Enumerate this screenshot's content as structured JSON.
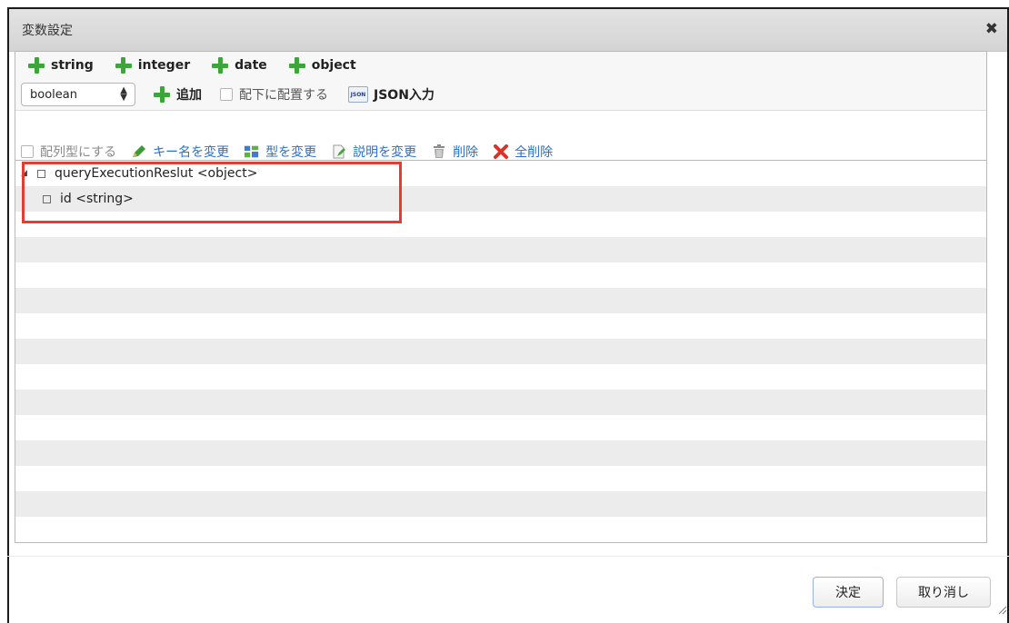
{
  "dialog": {
    "title": "変数設定"
  },
  "type_buttons": [
    "string",
    "integer",
    "date",
    "object"
  ],
  "row2": {
    "selected_type": "boolean",
    "add_label": "追加",
    "child_checkbox_label": "配下に配置する",
    "json_label": "JSON入力",
    "json_icon_text": "JSON"
  },
  "ops": {
    "array_checkbox_label": "配列型にする",
    "rename_key": "キー名を変更",
    "change_type": "型を変更",
    "change_desc": "説明を変更",
    "delete": "削除",
    "delete_all": "全削除"
  },
  "tree": {
    "nodes": [
      {
        "label": "queryExecutionReslut <object>",
        "expanded": true
      },
      {
        "label": "id <string>"
      }
    ]
  },
  "footer": {
    "ok": "決定",
    "cancel": "取り消し"
  },
  "colors": {
    "accent_green": "#3ea53a",
    "link_blue": "#2a6fd1",
    "highlight_red": "#e43b33"
  }
}
